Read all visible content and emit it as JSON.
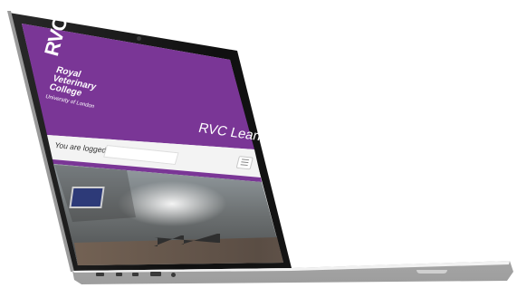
{
  "brand": {
    "logo_mark": "RVC",
    "logo_line1": "Royal",
    "logo_line2": "Veterinary",
    "logo_line3": "College",
    "logo_sub": "University of London"
  },
  "header": {
    "app_title": "RVC Learn"
  },
  "login": {
    "status_text": "You are logged in",
    "field_value": ""
  },
  "menu": {
    "icon": "hamburger-menu-icon"
  },
  "colors": {
    "brand_purple": "#7a3696",
    "login_bar": "#f3f3f3"
  }
}
